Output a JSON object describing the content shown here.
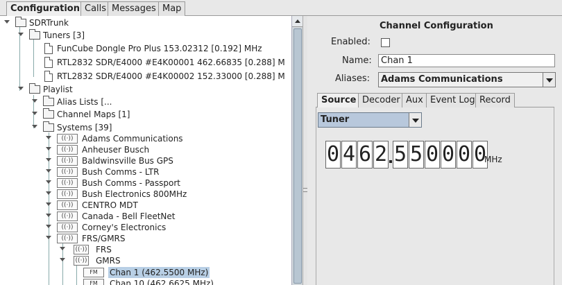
{
  "tabs": [
    "Configuration",
    "Calls",
    "Messages",
    "Map"
  ],
  "tree": {
    "root": "SDRTrunk",
    "tuners_label": "Tuners [3]",
    "tuners": [
      "FunCube Dongle Pro Plus  153.02312 [0.192] MHz",
      "RTL2832 SDR/E4000 #E4K00001  462.66835 [0.288] M",
      "RTL2832 SDR/E4000 #E4K00002  152.33000 [0.288] M"
    ],
    "playlist_label": "Playlist",
    "alias_lists": "Alias Lists [...",
    "channel_maps": "Channel Maps [1]",
    "systems_label": "Systems [39]",
    "systems": [
      "Adams Communications",
      "Anheuser Busch",
      "Baldwinsville Bus GPS",
      "Bush Comms - LTR",
      "Bush Comms - Passport",
      "Bush Electronics 800MHz",
      "CENTRO MDT",
      "Canada - Bell FleetNet",
      "Corney's Electronics",
      "FRS/GMRS"
    ],
    "frs": "FRS",
    "gmrs": "GMRS",
    "channels": [
      "Chan 1 (462.5500 MHz)",
      "Chan 10 (462.6625 MHz)"
    ],
    "fm_icon_text": "FM",
    "radio_icon_text": "((·))"
  },
  "config": {
    "title": "Channel Configuration",
    "enabled_label": "Enabled:",
    "enabled": false,
    "name_label": "Name:",
    "name_value": "Chan 1",
    "aliases_label": "Aliases:",
    "aliases_value": "Adams Communications",
    "subtabs": [
      "Source",
      "Decoder",
      "Aux",
      "Event Log",
      "Record"
    ],
    "active_subtab": "Source",
    "source_type": "Tuner",
    "frequency_digits": [
      "0",
      "4",
      "6",
      "2",
      "5",
      "5",
      "0",
      "0",
      "0",
      "0"
    ],
    "frequency_unit": "MHz"
  }
}
